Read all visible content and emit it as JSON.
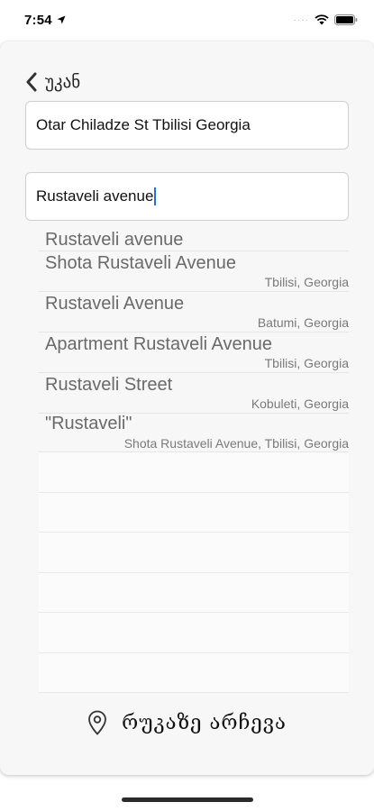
{
  "status_bar": {
    "time": "7:54",
    "signal": "····"
  },
  "header": {
    "back_label": "უკან"
  },
  "origin": {
    "value": "Otar Chiladze St Tbilisi Georgia"
  },
  "destination": {
    "value": "Rustaveli avenue"
  },
  "results": [
    {
      "title": "Rustaveli avenue",
      "subtitle": ""
    },
    {
      "title": "Shota Rustaveli Avenue",
      "subtitle": "Tbilisi, Georgia"
    },
    {
      "title": "Rustaveli Avenue",
      "subtitle": "Batumi, Georgia"
    },
    {
      "title": "Apartment Rustaveli Avenue",
      "subtitle": "Tbilisi, Georgia"
    },
    {
      "title": "Rustaveli Street",
      "subtitle": "Kobuleti, Georgia"
    },
    {
      "title": "\"Rustaveli\"",
      "subtitle": "Shota Rustaveli Avenue, Tbilisi, Georgia"
    }
  ],
  "map_choose": {
    "label": "რუკაზე არჩევა"
  }
}
